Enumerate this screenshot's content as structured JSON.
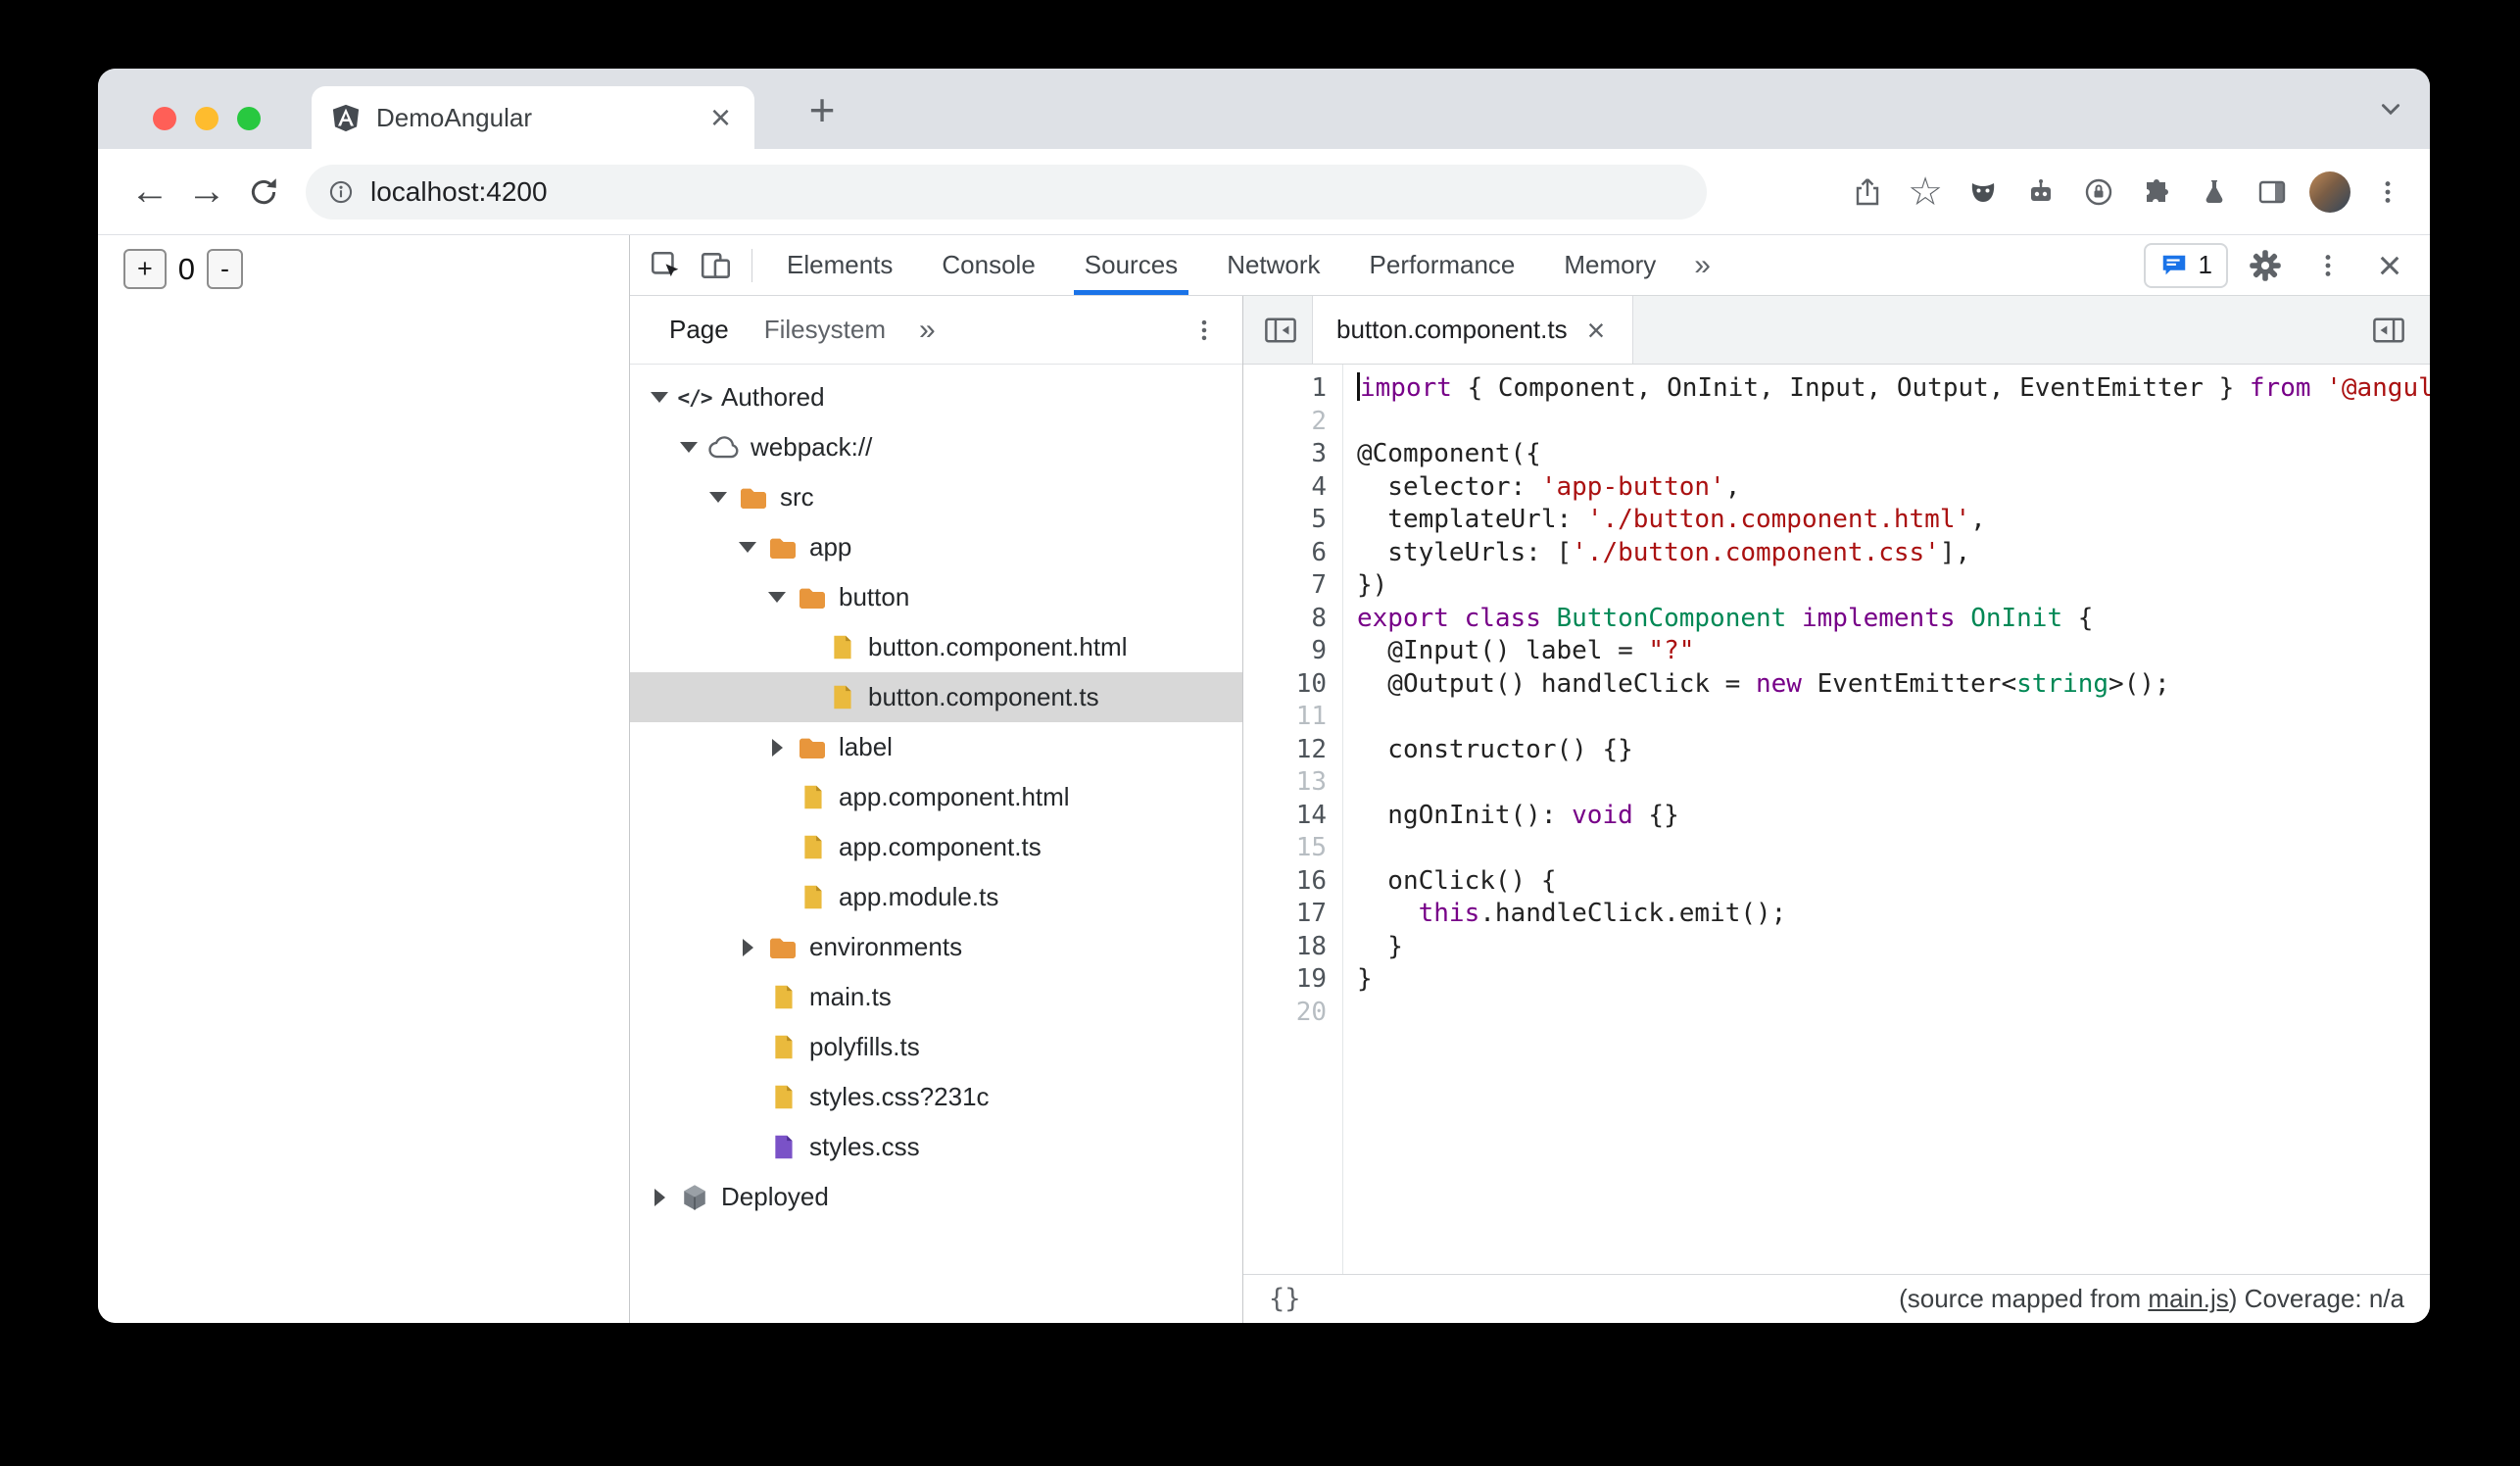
{
  "window": {
    "tab_title": "DemoAngular",
    "tab_close_label": "×",
    "new_tab_label": "+",
    "url": "localhost:4200"
  },
  "page": {
    "increment_button": "+",
    "counter_value": "0",
    "decrement_button": "-"
  },
  "devtools": {
    "panel_tabs": [
      {
        "label": "Elements",
        "active": false
      },
      {
        "label": "Console",
        "active": false
      },
      {
        "label": "Sources",
        "active": true
      },
      {
        "label": "Network",
        "active": false
      },
      {
        "label": "Performance",
        "active": false
      },
      {
        "label": "Memory",
        "active": false
      }
    ],
    "more_tabs_label": "»",
    "messages_count": "1",
    "close_label": "×",
    "navigator": {
      "tabs": [
        {
          "label": "Page",
          "active": true
        },
        {
          "label": "Filesystem",
          "active": false
        }
      ],
      "more_label": "»",
      "tree": [
        {
          "depth": 0,
          "type": "authored",
          "label": "Authored",
          "arrow": "down"
        },
        {
          "depth": 1,
          "type": "cloud",
          "label": "webpack://",
          "arrow": "down"
        },
        {
          "depth": 2,
          "type": "folder",
          "label": "src",
          "arrow": "down"
        },
        {
          "depth": 3,
          "type": "folder",
          "label": "app",
          "arrow": "down"
        },
        {
          "depth": 4,
          "type": "folder",
          "label": "button",
          "arrow": "down"
        },
        {
          "depth": 5,
          "type": "file",
          "label": "button.component.html"
        },
        {
          "depth": 5,
          "type": "file",
          "label": "button.component.ts",
          "selected": true
        },
        {
          "depth": 4,
          "type": "folder",
          "label": "label",
          "arrow": "right"
        },
        {
          "depth": 4,
          "type": "file",
          "label": "app.component.html"
        },
        {
          "depth": 4,
          "type": "file",
          "label": "app.component.ts"
        },
        {
          "depth": 4,
          "type": "file",
          "label": "app.module.ts"
        },
        {
          "depth": 3,
          "type": "folder",
          "label": "environments",
          "arrow": "right"
        },
        {
          "depth": 3,
          "type": "file",
          "label": "main.ts"
        },
        {
          "depth": 3,
          "type": "file",
          "label": "polyfills.ts"
        },
        {
          "depth": 3,
          "type": "file",
          "label": "styles.css?231c"
        },
        {
          "depth": 3,
          "type": "file-css",
          "label": "styles.css"
        },
        {
          "depth": 0,
          "type": "deployed",
          "label": "Deployed",
          "arrow": "right"
        }
      ]
    },
    "editor": {
      "tab_label": "button.component.ts",
      "tab_close_label": "×",
      "lines": [
        {
          "n": "1",
          "caret": true,
          "tokens": [
            [
              "k",
              "import"
            ],
            [
              "p",
              " { Component, OnInit, Input, Output, EventEmitter } "
            ],
            [
              "k",
              "from"
            ],
            [
              "p",
              " "
            ],
            [
              "s",
              "'@angular/core';"
            ]
          ]
        },
        {
          "n": "2",
          "tokens": []
        },
        {
          "n": "3",
          "tokens": [
            [
              "p",
              "@Component({"
            ]
          ]
        },
        {
          "n": "4",
          "tokens": [
            [
              "p",
              "  selector: "
            ],
            [
              "s",
              "'app-button'"
            ],
            [
              "p",
              ","
            ]
          ]
        },
        {
          "n": "5",
          "tokens": [
            [
              "p",
              "  templateUrl: "
            ],
            [
              "s",
              "'./button.component.html'"
            ],
            [
              "p",
              ","
            ]
          ]
        },
        {
          "n": "6",
          "tokens": [
            [
              "p",
              "  styleUrls: ["
            ],
            [
              "s",
              "'./button.component.css'"
            ],
            [
              "p",
              "],"
            ]
          ]
        },
        {
          "n": "7",
          "tokens": [
            [
              "p",
              "})"
            ]
          ]
        },
        {
          "n": "8",
          "tokens": [
            [
              "k",
              "export"
            ],
            [
              "p",
              " "
            ],
            [
              "k",
              "class"
            ],
            [
              "p",
              " "
            ],
            [
              "t",
              "ButtonComponent"
            ],
            [
              "p",
              " "
            ],
            [
              "k",
              "implements"
            ],
            [
              "p",
              " "
            ],
            [
              "t",
              "OnInit"
            ],
            [
              "p",
              " {"
            ]
          ]
        },
        {
          "n": "9",
          "tokens": [
            [
              "p",
              "  @Input() label = "
            ],
            [
              "s",
              "\"?\""
            ]
          ]
        },
        {
          "n": "10",
          "tokens": [
            [
              "p",
              "  @Output() handleClick = "
            ],
            [
              "k",
              "new"
            ],
            [
              "p",
              " EventEmitter<"
            ],
            [
              "t",
              "string"
            ],
            [
              "p",
              ">();"
            ]
          ]
        },
        {
          "n": "11",
          "tokens": []
        },
        {
          "n": "12",
          "tokens": [
            [
              "p",
              "  constructor() {}"
            ]
          ]
        },
        {
          "n": "13",
          "tokens": []
        },
        {
          "n": "14",
          "tokens": [
            [
              "p",
              "  ngOnInit(): "
            ],
            [
              "k",
              "void"
            ],
            [
              "p",
              " {}"
            ]
          ]
        },
        {
          "n": "15",
          "tokens": []
        },
        {
          "n": "16",
          "tokens": [
            [
              "p",
              "  onClick() {"
            ]
          ]
        },
        {
          "n": "17",
          "tokens": [
            [
              "p",
              "    "
            ],
            [
              "k",
              "this"
            ],
            [
              "p",
              ".handleClick.emit();"
            ]
          ]
        },
        {
          "n": "18",
          "tokens": [
            [
              "p",
              "  }"
            ]
          ]
        },
        {
          "n": "19",
          "tokens": [
            [
              "p",
              "}"
            ]
          ]
        },
        {
          "n": "20",
          "tokens": []
        }
      ],
      "status_bar": {
        "format_label": "{}",
        "mapped_prefix": "(source mapped from ",
        "mapped_link": "main.js",
        "mapped_suffix": ") Coverage: n/a"
      }
    }
  },
  "colors": {
    "accent": "#1a73e8",
    "keyword": "#770088",
    "string": "#aa1111",
    "type": "#008855",
    "selected_row": "#d8d8d8",
    "folder_icon": "#e8963c",
    "file_icon": "#eaba3d",
    "css_file_icon": "#7a52c7"
  }
}
